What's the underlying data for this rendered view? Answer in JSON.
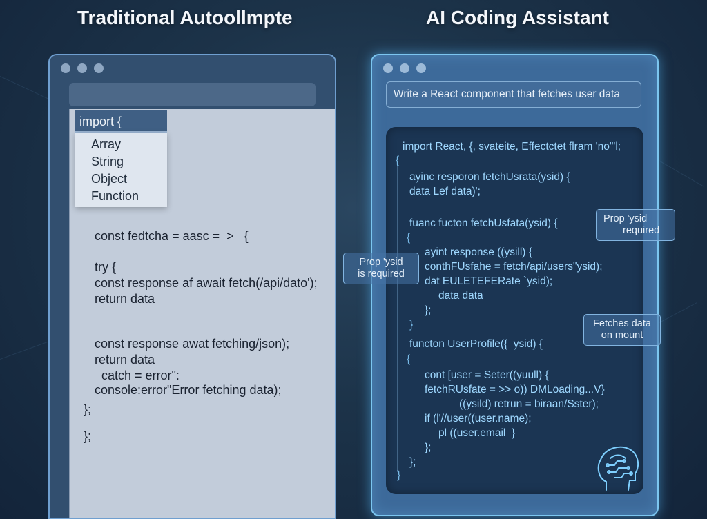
{
  "titles": {
    "left": "Traditional Autoollmpte",
    "right": "AI Coding Assistant"
  },
  "left": {
    "import_line": "import {",
    "dropdown": [
      "Array",
      "String",
      "Object",
      "Function"
    ],
    "code": [
      "const fedtcha = aasc =  >   {",
      "try {",
      "const response af await fetch(/api/dato');",
      "return data",
      "const response awat fetching/json);",
      "return data",
      "  catch = error\":",
      "console:error\"Error fetching data);",
      "};",
      "};"
    ]
  },
  "right": {
    "prompt": "Write a React component that fetches user data",
    "code": [
      "import React, {, svateite, Effectctet flram 'no\"'l;",
      "{",
      "ayinc resporon fetchUsrata(ysid) {",
      "data Lef data)';",
      "fuanc fucton fetchUsfata(ysid) {",
      "{",
      "ayint response ((ysill) {",
      "conthFUsfahe = fetch/api/users\"ysid);",
      "dat EULETEFERate `ysid);",
      "data data",
      "};",
      "}",
      "functon UserProfile({  ysid) {",
      "{",
      "cont [user = Seter((yuull) {",
      "fetchRUsfate = >> o)) DMLoading...V}",
      "((ysild) retrun = biraan/Sster);",
      "if (l'//user((user.name);",
      "pl ((user.email  }",
      "};",
      "};",
      "}"
    ]
  },
  "tooltips": {
    "prop_left": [
      "Prop 'ysid",
      "is required"
    ],
    "prop_right": [
      "Prop 'ysid",
      "required"
    ],
    "fetches": [
      "Fetches data",
      "on mount"
    ]
  }
}
